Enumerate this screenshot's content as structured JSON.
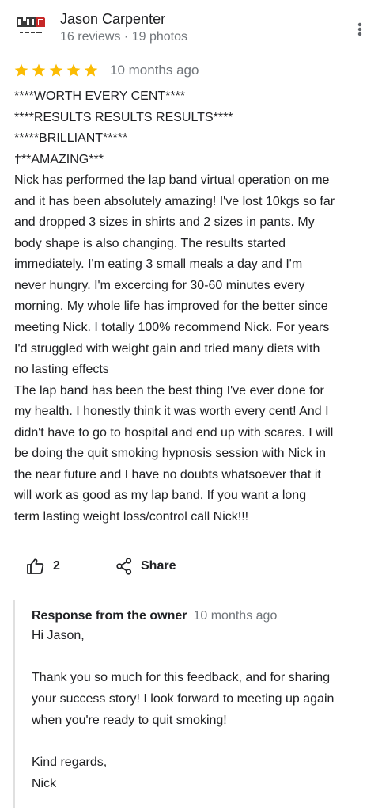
{
  "reviewer": {
    "name": "Jason Carpenter",
    "meta": "16 reviews · 19 photos",
    "avatar_icon": "business-logo-avatar"
  },
  "review": {
    "rating": 5,
    "max_rating": 5,
    "star_color": "#fbbc04",
    "date": "10 months ago",
    "lines": [
      "****WORTH EVERY CENT****",
      "****RESULTS RESULTS RESULTS****",
      "*****BRILLIANT*****",
      "†**AMAZING***",
      "Nick has performed the lap band virtual operation on me",
      "and it has been absolutely amazing! I've lost 10kgs so far",
      "and dropped 3 sizes in shirts and 2 sizes in pants. My",
      "body shape is also changing. The results started",
      "immediately. I'm eating 3 small meals a day and I'm",
      "never hungry. I'm excercing for 30-60 minutes every",
      "morning. My whole life has improved for the better since",
      "meeting Nick. I totally 100% recommend Nick. For years",
      "I'd struggled with weight gain and tried many diets with",
      "no lasting effects",
      "The lap band has been the best thing I've ever done for",
      "my health. I honestly think it was worth every cent! And I",
      "didn't have to go to hospital and end up with scares. I will",
      "be doing the quit smoking hypnosis session with Nick in",
      "the near future and I have no doubts whatsoever that it",
      "will work as good as my lap band. If you want a long",
      "term lasting weight loss/control call Nick!!!"
    ]
  },
  "actions": {
    "like_count": "2",
    "like_icon": "thumbs-up-icon",
    "share_label": "Share",
    "share_icon": "share-icon",
    "more_icon": "more-vert-icon"
  },
  "owner_response": {
    "label": "Response from the owner",
    "date": "10 months ago",
    "lines": [
      "Hi Jason,",
      "",
      "Thank you so much for this feedback, and for sharing",
      "your success story! I look forward to meeting up again",
      "when you're ready to quit smoking!",
      "",
      "Kind regards,",
      "Nick"
    ]
  }
}
